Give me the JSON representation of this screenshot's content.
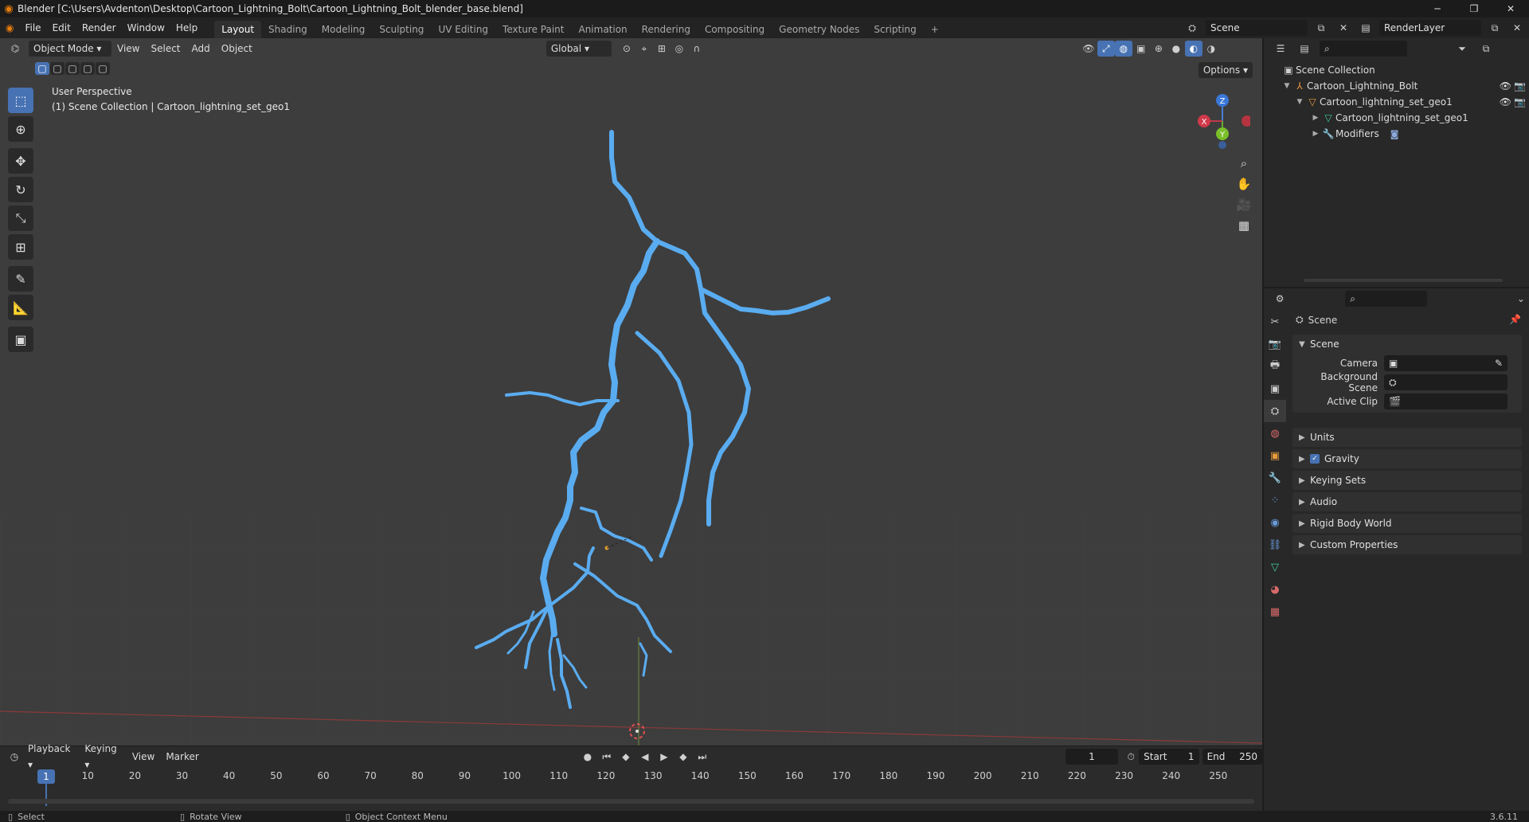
{
  "window": {
    "title": "Blender [C:\\Users\\Avdenton\\Desktop\\Cartoon_Lightning_Bolt\\Cartoon_Lightning_Bolt_blender_base.blend]",
    "minimize": "─",
    "maximize": "❐",
    "close": "✕"
  },
  "menubar": {
    "items": [
      "File",
      "Edit",
      "Render",
      "Window",
      "Help"
    ],
    "workspaces": [
      "Layout",
      "Shading",
      "Modeling",
      "Sculpting",
      "UV Editing",
      "Texture Paint",
      "Animation",
      "Rendering",
      "Compositing",
      "Geometry Nodes",
      "Scripting"
    ],
    "add_tab": "+",
    "scene": "Scene",
    "render_layer": "RenderLayer"
  },
  "viewport": {
    "mode": "Object Mode",
    "menus": [
      "View",
      "Select",
      "Add",
      "Object"
    ],
    "orientation": "Global",
    "options": "Options",
    "perspective": "User Perspective",
    "collection_info": "(1) Scene Collection | Cartoon_lightning_set_geo1",
    "gizmo": {
      "z": "Z",
      "y": "Y",
      "x": "X"
    },
    "bolt_color": "#5aacf0"
  },
  "timeline": {
    "menus": [
      "Playback",
      "Keying",
      "View",
      "Marker"
    ],
    "current_frame": "1",
    "start_label": "Start",
    "start": "1",
    "end_label": "End",
    "end": "250",
    "cursor_frame": "1",
    "ticks": [
      "10",
      "20",
      "30",
      "40",
      "50",
      "60",
      "70",
      "80",
      "90",
      "100",
      "110",
      "120",
      "130",
      "140",
      "150",
      "160",
      "170",
      "180",
      "190",
      "200",
      "210",
      "220",
      "230",
      "240",
      "250"
    ]
  },
  "statusbar": {
    "select": "Select",
    "rotate": "Rotate View",
    "context": "Object Context Menu",
    "version": "3.6.11"
  },
  "outliner": {
    "root": "Scene Collection",
    "items": [
      {
        "label": "Cartoon_Lightning_Bolt"
      },
      {
        "label": "Cartoon_lightning_set_geo1"
      },
      {
        "label": "Cartoon_lightning_set_geo1"
      },
      {
        "label": "Modifiers"
      }
    ]
  },
  "properties": {
    "header": "Scene",
    "panel_scene": "Scene",
    "camera_label": "Camera",
    "background_label": "Background Scene",
    "clip_label": "Active Clip",
    "collapsed": [
      "Units",
      "Gravity",
      "Keying Sets",
      "Audio",
      "Rigid Body World",
      "Custom Properties"
    ]
  }
}
